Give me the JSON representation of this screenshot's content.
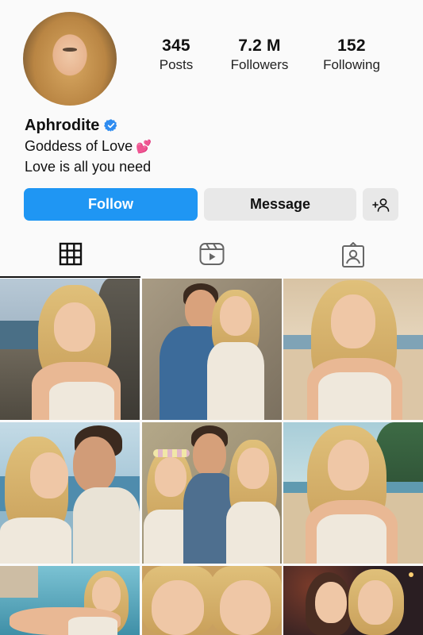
{
  "profile": {
    "name": "Aphrodite",
    "verified": true,
    "bio_line1": "Goddess of Love",
    "bio_emoji": "💕",
    "bio_line2": "Love is all you need"
  },
  "stats": {
    "posts_count": "345",
    "posts_label": "Posts",
    "followers_count": "7.2 M",
    "followers_label": "Followers",
    "following_count": "152",
    "following_label": "Following"
  },
  "actions": {
    "follow_label": "Follow",
    "message_label": "Message",
    "suggest_icon": "add-person-icon"
  },
  "tabs": [
    {
      "icon": "grid-icon",
      "active": true
    },
    {
      "icon": "reels-icon",
      "active": false
    },
    {
      "icon": "tagged-icon",
      "active": false
    }
  ],
  "colors": {
    "accent": "#1f96f3",
    "verified_badge": "#2f8cf0",
    "button_gray": "#e8e8e8"
  },
  "posts": [
    {
      "scene": "woman on rocky beach"
    },
    {
      "scene": "couple by stone wall with champagne"
    },
    {
      "scene": "woman on beach at sunset"
    },
    {
      "scene": "couple kissing by the sea"
    },
    {
      "scene": "three friends with flower crown"
    },
    {
      "scene": "woman on tropical beach"
    },
    {
      "scene": "woman lounging by pool"
    },
    {
      "scene": "two women close-up"
    },
    {
      "scene": "two women at night party"
    }
  ]
}
